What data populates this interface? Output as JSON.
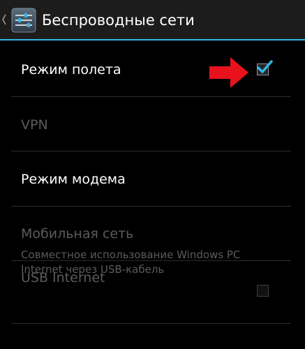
{
  "action_bar": {
    "title": "Беспроводные сети",
    "icon": "settings-sliders-icon",
    "up_icon": "chevron-left-icon",
    "accent_color": "#33b5e5"
  },
  "items": [
    {
      "title": "Режим полета",
      "enabled": true,
      "checkbox": true,
      "checked": true
    },
    {
      "title": "VPN",
      "enabled": false
    },
    {
      "title": "Режим модема",
      "enabled": true
    },
    {
      "title": "Мобильная сеть",
      "enabled": false
    },
    {
      "title": "USB Internet",
      "summary": "Совместное использование Windows PC Internet через USB-кабель",
      "enabled": false,
      "checkbox": true,
      "checked": false
    }
  ],
  "annotation": {
    "icon": "red-arrow-icon",
    "color": "#e8121c"
  }
}
